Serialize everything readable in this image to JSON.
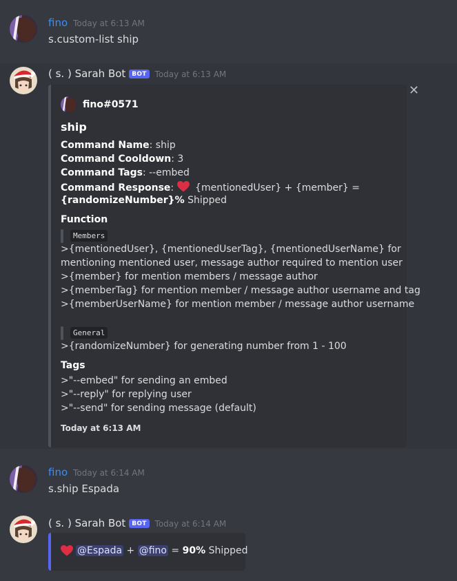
{
  "messages": [
    {
      "author": "fino",
      "timestamp": "Today at 6:13 AM",
      "content": "s.custom-list ship"
    },
    {
      "author": "( s. ) Sarah Bot",
      "bot_tag": "BOT",
      "timestamp": "Today at 6:13 AM",
      "embed": {
        "author_name": "fino#0571",
        "title": "ship",
        "close_glyph": "✕",
        "lines": {
          "command_name_label": "Command Name",
          "command_name_value": ": ship",
          "cooldown_label": "Command Cooldown",
          "cooldown_value": ": 3",
          "tags_label": "Command Tags",
          "tags_value": ": --embed",
          "response_label": "Command Response",
          "response_value": " {mentionedUser} + {member} =",
          "response_line2_bold": "{randomizeNumber}%",
          "response_line2_rest": " Shipped"
        },
        "function_label": "Function",
        "members_code": "Members",
        "members_lines": [
          ">{mentionedUser}, {mentionedUserTag}, {mentionedUserName} for",
          "mentioning mentioned user, message author required to mention user",
          ">{member} for mention members / message author",
          ">{memberTag} for mention member / message author username and tag",
          ">{memberUserName} for mention member / message author username"
        ],
        "general_code": "General",
        "general_line": ">{randomizeNumber} for generating number from 1 - 100",
        "tags_field_label": "Tags",
        "tags_lines": [
          ">\"--embed\" for sending an embed",
          ">\"--reply\" for replying user",
          ">\"--send\" for sending message (default)"
        ],
        "footer": "Today at 6:13 AM"
      }
    },
    {
      "author": "fino",
      "timestamp": "Today at 6:14 AM",
      "content": "s.ship Espada"
    },
    {
      "author": "( s. ) Sarah Bot",
      "bot_tag": "BOT",
      "timestamp": "Today at 6:14 AM",
      "embed": {
        "mention1": "@Espada",
        "plus": " + ",
        "mention2": "@fino",
        "equals": " = ",
        "percent": "90%",
        "suffix": " Shipped"
      }
    }
  ],
  "icons": [
    "heart-icon",
    "close-icon"
  ],
  "colors": {
    "background": "#36393f",
    "embed_bg": "#2f3136",
    "fino_name": "#3b8ff3",
    "bot_badge": "#5865f2",
    "heart": "#dd2e44"
  }
}
